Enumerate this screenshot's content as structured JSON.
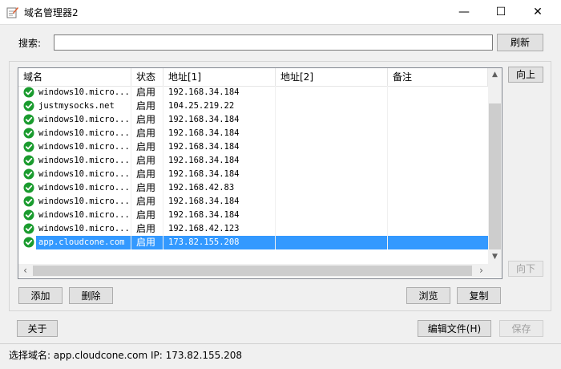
{
  "window": {
    "title": "域名管理器2",
    "minimize_glyph": "—",
    "maximize_glyph": "☐",
    "close_glyph": "✕"
  },
  "search": {
    "label": "搜索:",
    "value": "",
    "refresh_label": "刷新"
  },
  "list": {
    "columns": [
      "域名",
      "状态",
      "地址[1]",
      "地址[2]",
      "备注"
    ],
    "rows": [
      {
        "name": "windows10.micro...",
        "status": "启用",
        "addr1": "192.168.34.184",
        "addr2": "",
        "note": "",
        "selected": false
      },
      {
        "name": "justmysocks.net",
        "status": "启用",
        "addr1": "104.25.219.22",
        "addr2": "",
        "note": "",
        "selected": false
      },
      {
        "name": "windows10.micro...",
        "status": "启用",
        "addr1": "192.168.34.184",
        "addr2": "",
        "note": "",
        "selected": false
      },
      {
        "name": "windows10.micro...",
        "status": "启用",
        "addr1": "192.168.34.184",
        "addr2": "",
        "note": "",
        "selected": false
      },
      {
        "name": "windows10.micro...",
        "status": "启用",
        "addr1": "192.168.34.184",
        "addr2": "",
        "note": "",
        "selected": false
      },
      {
        "name": "windows10.micro...",
        "status": "启用",
        "addr1": "192.168.34.184",
        "addr2": "",
        "note": "",
        "selected": false
      },
      {
        "name": "windows10.micro...",
        "status": "启用",
        "addr1": "192.168.34.184",
        "addr2": "",
        "note": "",
        "selected": false
      },
      {
        "name": "windows10.micro...",
        "status": "启用",
        "addr1": "192.168.42.83",
        "addr2": "",
        "note": "",
        "selected": false
      },
      {
        "name": "windows10.micro...",
        "status": "启用",
        "addr1": "192.168.34.184",
        "addr2": "",
        "note": "",
        "selected": false
      },
      {
        "name": "windows10.micro...",
        "status": "启用",
        "addr1": "192.168.34.184",
        "addr2": "",
        "note": "",
        "selected": false
      },
      {
        "name": "windows10.micro...",
        "status": "启用",
        "addr1": "192.168.42.123",
        "addr2": "",
        "note": "",
        "selected": false
      },
      {
        "name": "app.cloudcone.com",
        "status": "启用",
        "addr1": "173.82.155.208",
        "addr2": "",
        "note": "",
        "selected": true
      }
    ]
  },
  "side_buttons": {
    "up_label": "向上",
    "down_label": "向下"
  },
  "actions": {
    "add_label": "添加",
    "delete_label": "删除",
    "browse_label": "浏览",
    "copy_label": "复制",
    "about_label": "关于",
    "edit_file_label": "编辑文件(H)",
    "save_label": "保存"
  },
  "statusbar": {
    "text": "选择域名: app.cloudcone.com IP: 173.82.155.208"
  },
  "colors": {
    "selection": "#3399ff",
    "check_green": "#1a9b2e"
  },
  "icons": {
    "app": "app-notepad-icon",
    "row_status": "check-circle-icon"
  }
}
